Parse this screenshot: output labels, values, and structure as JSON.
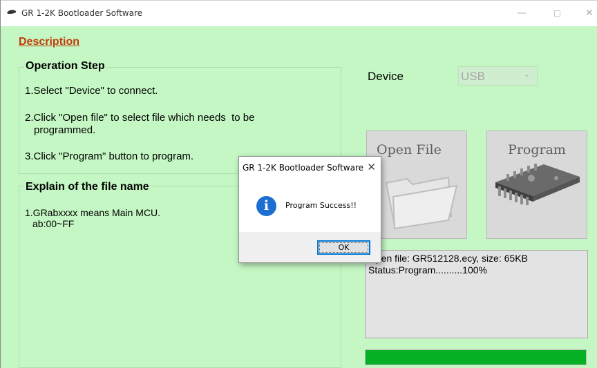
{
  "window": {
    "title": "GR 1-2K Bootloader Software",
    "controls": {
      "minimize": "—",
      "maximize": "☐",
      "close": "✕"
    },
    "background_color": "#c4f7c4"
  },
  "description_link": "Description",
  "operation_step": {
    "title": "Operation Step",
    "steps": [
      "1.Select \"Device\" to connect.",
      "2.Click \"Open file\" to select file which needs  to be",
      "programmed.",
      "3.Click \"Program\" button to program."
    ]
  },
  "explain": {
    "title": "Explain of the file name",
    "lines": [
      "1.GRabxxxx means Main MCU.",
      "ab:00~FF"
    ]
  },
  "device": {
    "label": "Device",
    "selected": "USB"
  },
  "buttons": {
    "open_file": "Open File",
    "program": "Program"
  },
  "log": {
    "lines": [
      "Open file: GR512128.ecy, size: 65KB",
      "Status:Program..........100%"
    ]
  },
  "progress": {
    "value": 1.0,
    "color": "#06b025"
  },
  "dialog": {
    "title": "GR 1-2K Bootloader Software",
    "close": "✕",
    "icon": "info-icon",
    "icon_glyph": "i",
    "message": "Program Success!!",
    "ok_label": "OK"
  }
}
